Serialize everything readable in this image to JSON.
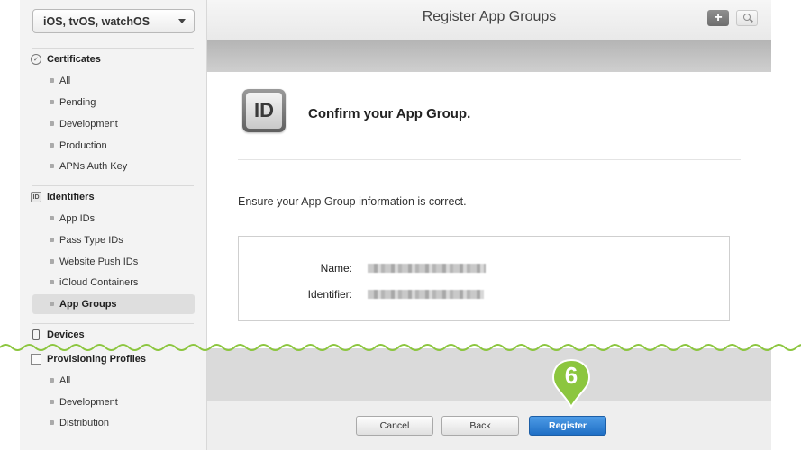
{
  "sidebar": {
    "platform_select": "iOS, tvOS, watchOS",
    "sections": [
      {
        "label": "Certificates",
        "icon": "certificate-icon",
        "items": [
          "All",
          "Pending",
          "Development",
          "Production",
          "APNs Auth Key"
        ]
      },
      {
        "label": "Identifiers",
        "icon": "id-icon",
        "items": [
          "App IDs",
          "Pass Type IDs",
          "Website Push IDs",
          "iCloud Containers",
          "App Groups"
        ]
      },
      {
        "label": "Devices",
        "icon": "device-icon",
        "items": []
      },
      {
        "label": "Provisioning Profiles",
        "icon": "document-icon",
        "items": [
          "All",
          "Development",
          "Distribution"
        ]
      }
    ],
    "active_item": "App Groups"
  },
  "header": {
    "title": "Register App Groups",
    "add_icon": "plus-icon",
    "search_icon": "search-icon"
  },
  "main": {
    "badge_text": "ID",
    "confirm_title": "Confirm your App Group.",
    "instruction": "Ensure your App Group information is correct.",
    "name_label": "Name:",
    "identifier_label": "Identifier:"
  },
  "footer": {
    "cancel_label": "Cancel",
    "back_label": "Back",
    "register_label": "Register"
  },
  "step_marker": "6",
  "colors": {
    "accent_green": "#8cc63f",
    "primary_blue": "#2f80d6"
  }
}
